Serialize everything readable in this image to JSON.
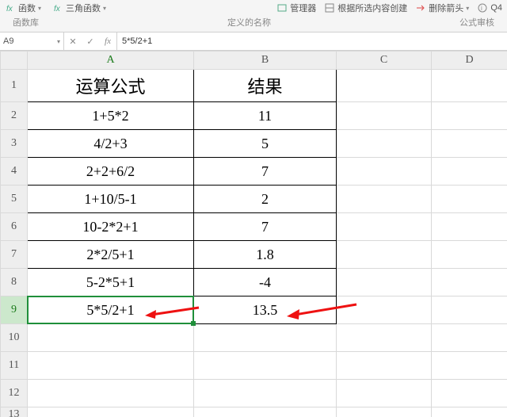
{
  "ribbon": {
    "items": [
      {
        "label": "函数",
        "icon": "fx"
      },
      {
        "label": "三角函数",
        "icon": "fx"
      }
    ],
    "right_items": [
      {
        "label": "管理器",
        "icon": "manager"
      },
      {
        "label": "根据所选内容创建",
        "icon": "create"
      },
      {
        "label": "删除箭头",
        "icon": "delete-arrow"
      },
      {
        "label": "Q4",
        "icon": "info"
      }
    ],
    "group_left": "函数库",
    "group_mid": "定义的名称",
    "group_right": "公式审核"
  },
  "namebox": "A9",
  "formula": "5*5/2+1",
  "cols": [
    "A",
    "B",
    "C",
    "D"
  ],
  "rows": [
    "1",
    "2",
    "3",
    "4",
    "5",
    "6",
    "7",
    "8",
    "9",
    "10",
    "11",
    "12",
    "13"
  ],
  "cells": {
    "A1": "运算公式",
    "B1": "结果",
    "A2": "1+5*2",
    "B2": "11",
    "A3": "4/2+3",
    "B3": "5",
    "A4": "2+2+6/2",
    "B4": "7",
    "A5": "1+10/5-1",
    "B5": "2",
    "A6": "10-2*2+1",
    "B6": "7",
    "A7": "2*2/5+1",
    "B7": "1.8",
    "A8": "5-2*5+1",
    "B8": "-4",
    "A9": "5*5/2+1",
    "B9": "13.5"
  },
  "selection": "A9",
  "chart_data": {
    "type": "table",
    "title": "",
    "columns": [
      "运算公式",
      "结果"
    ],
    "rows": [
      [
        "1+5*2",
        11
      ],
      [
        "4/2+3",
        5
      ],
      [
        "2+2+6/2",
        7
      ],
      [
        "1+10/5-1",
        2
      ],
      [
        "10-2*2+1",
        7
      ],
      [
        "2*2/5+1",
        1.8
      ],
      [
        "5-2*5+1",
        -4
      ],
      [
        "5*5/2+1",
        13.5
      ]
    ]
  }
}
